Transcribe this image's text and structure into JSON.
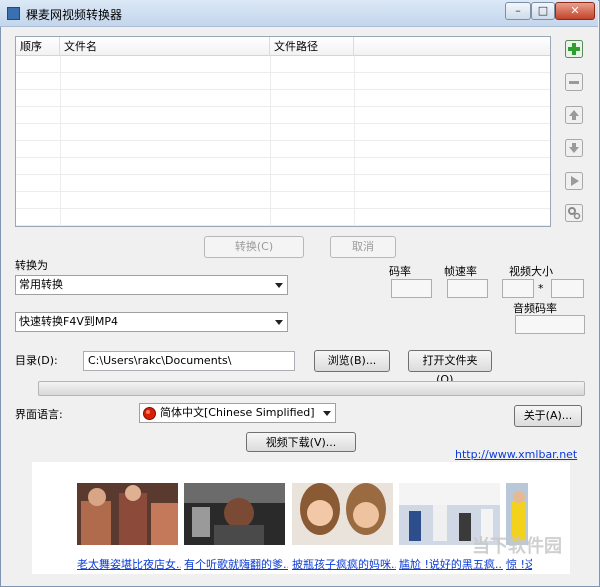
{
  "window": {
    "title": "稞麦网视频转换器",
    "min": "–",
    "max": "□",
    "close": "✕"
  },
  "list": {
    "headers": [
      "顺序",
      "文件名",
      "文件路径"
    ],
    "rows": []
  },
  "side_icons": [
    "add-icon",
    "remove-icon",
    "move-up-icon",
    "move-down-icon",
    "play-icon",
    "settings-icon"
  ],
  "actions": {
    "convert": "转换(C)",
    "cancel": "取消"
  },
  "convert_to": {
    "label": "转换为",
    "category": "常用转换",
    "preset": "快速转换F4V到MP4"
  },
  "params": {
    "bitrate": "码率",
    "framerate": "帧速率",
    "video_size": "视频大小",
    "size_sep": "*",
    "audio_bitrate": "音频码率"
  },
  "directory": {
    "label": "目录(D):",
    "path": "C:\\Users\\rakc\\Documents\\",
    "browse": "浏览(B)...",
    "open_folder": "打开文件夹(O)..."
  },
  "progress": {
    "value": 0
  },
  "language": {
    "label": "界面语言:",
    "selected": "简体中文[Chinese Simplified]",
    "about": "关于(A)..."
  },
  "download": {
    "label": "视频下载(V)..."
  },
  "website": "http://www.xmlbar.net",
  "ads": [
    {
      "caption": "老太舞姿堪比夜店女..."
    },
    {
      "caption": "有个听歌就嗨翻的爹..."
    },
    {
      "caption": "披瓶孩子疯疯的妈咪..."
    },
    {
      "caption": "尴尬 !说好的黑五疯..."
    },
    {
      "caption": "惊 !这"
    }
  ],
  "watermark": "当下软件园",
  "colors": {
    "accent_green": "#2e9e2e",
    "link": "#0b3bd6",
    "titlebar": "#c4d6ec"
  }
}
